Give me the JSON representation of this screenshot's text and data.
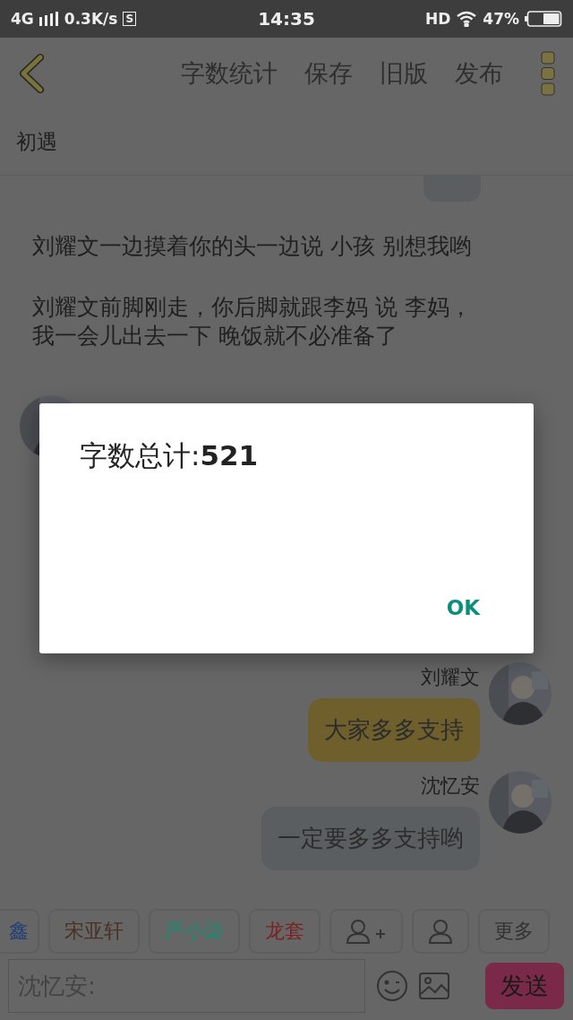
{
  "status_bar": {
    "network": "4G",
    "speed": "0.3K/s",
    "sim_badge": "S",
    "time": "14:35",
    "hd": "HD",
    "battery": "47%"
  },
  "toolbar": {
    "actions": [
      "字数统计",
      "保存",
      "旧版",
      "发布"
    ]
  },
  "chapter_title": "初遇",
  "messages": [
    {
      "kind": "partial_bubble"
    },
    {
      "kind": "narration",
      "text": "刘耀文一边摸着你的头一边说 小孩 别想我哟"
    },
    {
      "kind": "narration",
      "text": "刘耀文前脚刚走，你后脚就跟李妈 说 李妈，我一会儿出去一下 晚饭就不必准备了"
    },
    {
      "kind": "left_avatar"
    },
    {
      "kind": "speech",
      "name": "刘耀文",
      "text": "大家多多支持",
      "color": "#6f5f2c"
    },
    {
      "kind": "speech",
      "name": "沈忆安",
      "text": "一定要多多支持哟",
      "color": "#5a5e61"
    }
  ],
  "chips": [
    {
      "kind": "name",
      "label": "鑫",
      "color": "#1f3d78"
    },
    {
      "kind": "name",
      "label": "宋亚轩",
      "color": "#4a3022"
    },
    {
      "kind": "name",
      "label": "严小柒",
      "color": "#1c8a70"
    },
    {
      "kind": "name",
      "label": "龙套",
      "color": "#7c2222"
    },
    {
      "kind": "add_person"
    },
    {
      "kind": "person"
    },
    {
      "kind": "text",
      "label": "更多"
    }
  ],
  "input": {
    "placeholder": "沈忆安:"
  },
  "send_button": "发送",
  "dialog": {
    "title": "字数总计:",
    "count": "521",
    "button": "OK"
  }
}
